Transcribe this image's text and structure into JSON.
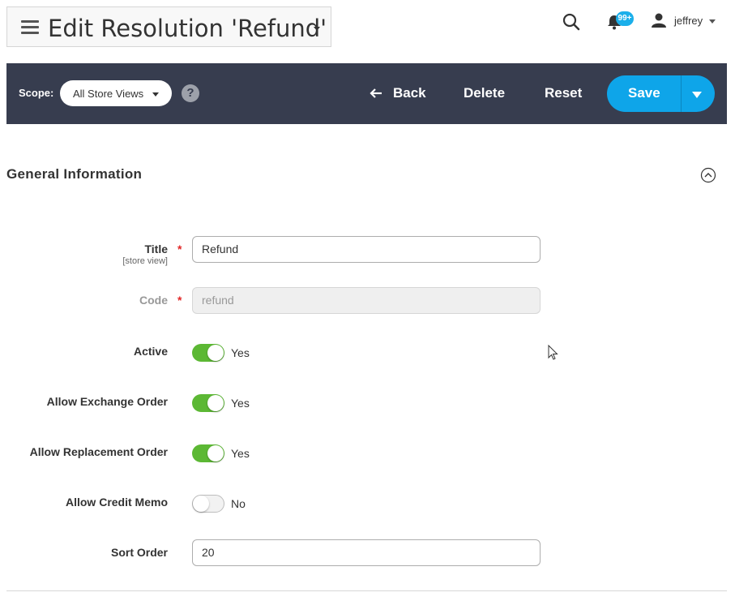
{
  "header": {
    "title": "Edit Resolution 'Refund'",
    "notifications_count": "99+",
    "user_name": "jeffrey"
  },
  "toolbar": {
    "scope_label": "Scope:",
    "scope_value": "All Store Views",
    "help_label": "?",
    "back_label": "Back",
    "delete_label": "Delete",
    "reset_label": "Reset",
    "save_label": "Save"
  },
  "section": {
    "title": "General Information"
  },
  "form": {
    "title": {
      "label": "Title",
      "scope_hint": "[store view]",
      "value": "Refund",
      "required": "*"
    },
    "code": {
      "label": "Code",
      "placeholder": "refund",
      "required": "*"
    },
    "active": {
      "label": "Active",
      "state": "Yes"
    },
    "allow_exchange": {
      "label": "Allow Exchange Order",
      "state": "Yes"
    },
    "allow_replacement": {
      "label": "Allow Replacement Order",
      "state": "Yes"
    },
    "allow_credit_memo": {
      "label": "Allow Credit Memo",
      "state": "No"
    },
    "sort_order": {
      "label": "Sort Order",
      "value": "20"
    }
  },
  "colors": {
    "toolbar_bg": "#373d4f",
    "save_button": "#0ea5e9",
    "toggle_on": "#5cb834",
    "required": "#e22626"
  }
}
